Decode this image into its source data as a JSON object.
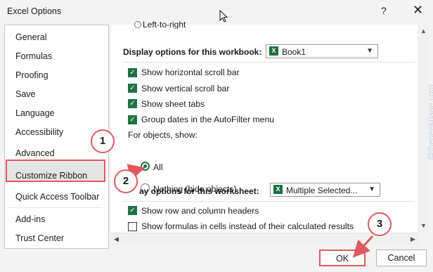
{
  "window": {
    "title": "Excel Options",
    "help_glyph": "?",
    "close_glyph": "✕"
  },
  "sidebar": {
    "items": [
      {
        "label": "General"
      },
      {
        "label": "Formulas"
      },
      {
        "label": "Proofing"
      },
      {
        "label": "Save"
      },
      {
        "label": "Language"
      },
      {
        "label": "Accessibility"
      },
      {
        "label": "Advanced",
        "selected": true
      },
      {
        "label": "Customize Ribbon"
      },
      {
        "label": "Quick Access Toolbar"
      },
      {
        "label": "Add-ins"
      },
      {
        "label": "Trust Center"
      }
    ]
  },
  "content": {
    "partial_top_option": "Left-to-right",
    "workbook_section": {
      "label": "Display options for this workbook:",
      "selected": "Book1",
      "options": [
        {
          "label": "Show horizontal scroll bar",
          "checked": true
        },
        {
          "label": "Show vertical scroll bar",
          "checked": true
        },
        {
          "label": "Show sheet tabs",
          "checked": true
        },
        {
          "label": "Group dates in the AutoFilter menu",
          "checked": true
        }
      ],
      "objects_label": "For objects, show:",
      "objects_options": [
        {
          "label": "All",
          "selected": true
        },
        {
          "label": "Nothing (hide objects)",
          "selected": false
        }
      ]
    },
    "worksheet_section": {
      "label": "ay options for this worksheet:",
      "selected": "Multiple Selected...",
      "options": [
        {
          "label": "Show row and column headers",
          "checked": true
        },
        {
          "label": "Show formulas in cells instead of their calculated results",
          "checked": false
        }
      ]
    }
  },
  "buttons": {
    "ok": "OK",
    "cancel": "Cancel"
  },
  "callouts": [
    "1",
    "2",
    "3"
  ],
  "watermark": "@thegeekpage.com",
  "colors": {
    "excel_green": "#1f7244",
    "annotation_red": "#e0595e",
    "selection_bg": "#e5e5e5"
  }
}
